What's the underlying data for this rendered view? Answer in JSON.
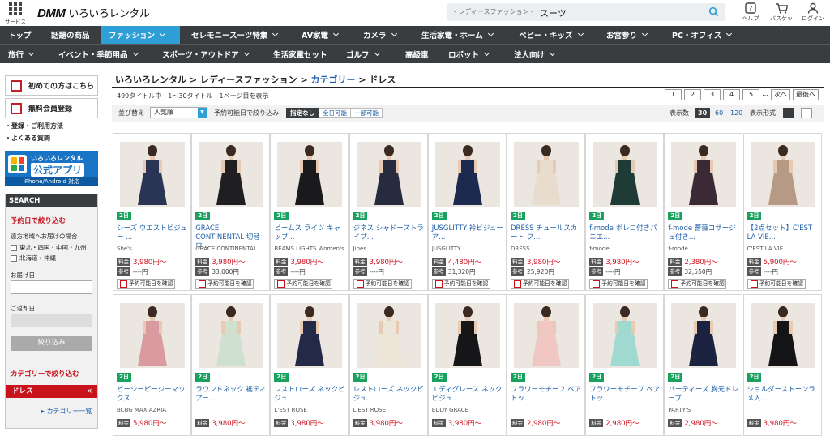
{
  "header": {
    "service_label": "サービス",
    "logo_brand": "DMM",
    "logo_site": "いろいろレンタル",
    "search": {
      "category": "- レディースファッション -",
      "query": "スーツ"
    },
    "icons": [
      {
        "label": "ヘルプ"
      },
      {
        "label": "バスケット"
      },
      {
        "label": "ログイン"
      }
    ]
  },
  "nav_row1": [
    "トップ",
    "話題の商品",
    "ファッション",
    "セレモニースーツ特集",
    "AV家電",
    "カメラ",
    "生活家電・ホーム",
    "ベビー・キッズ",
    "お宮参り",
    "PC・オフィス"
  ],
  "nav_row2": [
    "旅行",
    "イベント・季節用品",
    "スポーツ・アウトドア",
    "生活家電セット",
    "ゴルフ",
    "高級車",
    "ロボット",
    "法人向け"
  ],
  "sidebar": {
    "first_time": "初めての方はこちら",
    "register": "無料会員登録",
    "link_signup": "・登録・ご利用方法",
    "link_faq": "・よくある質問",
    "app_banner": {
      "line1": "いろいろレンタル",
      "line2": "公式アプリ",
      "line3": "iPhone/Android 対応"
    },
    "search_header": "SEARCH",
    "by_date": "予約日で絞り込む",
    "remote_label": "遠方地域へお届けの場合",
    "remote_opt1": "東北・四国・中国・九州",
    "remote_opt2": "北海道・沖縄",
    "delivery_date": "お届け日",
    "return_date": "ご返却日",
    "filter_button": "絞り込み",
    "by_category": "カテゴリーで絞り込む",
    "selected_category": "ドレス",
    "remove": "×",
    "category_list": "カテゴリー一覧"
  },
  "main": {
    "breadcrumb": {
      "a": "いろいろレンタル",
      "b": "レディースファッション",
      "c": "カテゴリー",
      "d": "ドレス",
      "sep": ">"
    },
    "count_text": "499タイトル中　1〜30タイトル　1ページ目を表示",
    "pager": [
      "1",
      "2",
      "3",
      "4",
      "5",
      "…",
      "次へ",
      "最後へ"
    ],
    "sort_label": "並び替え",
    "sort_value": "人気順",
    "avail_label": "予約可能日で絞り込み",
    "avail_opts": [
      "指定なし",
      "全日可能",
      "一部可能"
    ],
    "per_page_label": "表示数",
    "per_page": [
      "30",
      "60",
      "120"
    ],
    "format_label": "表示形式"
  },
  "products": [
    {
      "badge": "2日",
      "name": "シーズ ウエストビジュー ...",
      "brand": "She's",
      "price_tag": "料金",
      "price": "3,980円〜",
      "ref_tag": "参考",
      "ref": "----円",
      "avail": "予約可能日を確認",
      "dress": "#2a3454"
    },
    {
      "badge": "2日",
      "name": "GRACE CONTINENTAL 切替ワ...",
      "brand": "GRACE CONTINENTAL",
      "price_tag": "料金",
      "price": "3,980円〜",
      "ref_tag": "参考",
      "ref": "33,000円",
      "avail": "予約可能日を確認",
      "dress": "#1f1f22"
    },
    {
      "badge": "2日",
      "name": "ビームス ライツ キャップ...",
      "brand": "BEAMS LIGHTS Women's",
      "price_tag": "料金",
      "price": "3,980円〜",
      "ref_tag": "参考",
      "ref": "----円",
      "avail": "予約可能日を確認",
      "dress": "#1a1a1c"
    },
    {
      "badge": "2日",
      "name": "ジネス シャドーストライプ...",
      "brand": "Jines",
      "price_tag": "料金",
      "price": "3,980円〜",
      "ref_tag": "参考",
      "ref": "----円",
      "avail": "予約可能日を確認",
      "dress": "#262b3e"
    },
    {
      "badge": "2日",
      "name": "JUSGLITTY 衿ビジュー ア...",
      "brand": "JUSGLITTY",
      "price_tag": "料金",
      "price": "4,480円〜",
      "ref_tag": "参考",
      "ref": "31,320円",
      "avail": "予約可能日を確認",
      "dress": "#1d2a4f"
    },
    {
      "badge": "2日",
      "name": "DRESS チュールスカート フ...",
      "brand": "DRESS",
      "price_tag": "料金",
      "price": "3,980円〜",
      "ref_tag": "参考",
      "ref": "25,920円",
      "avail": "予約可能日を確認",
      "dress": "#e8dccd"
    },
    {
      "badge": "2日",
      "name": "f-mode ボレロ付きパニエ...",
      "brand": "f-mode",
      "price_tag": "料金",
      "price": "3,980円〜",
      "ref_tag": "参考",
      "ref": "----円",
      "avail": "予約可能日を確認",
      "dress": "#1f3b35"
    },
    {
      "badge": "2日",
      "name": "f-mode 薔薇コサージュ付き...",
      "brand": "f-mode",
      "price_tag": "料金",
      "price": "2,380円〜",
      "ref_tag": "参考",
      "ref": "32,550円",
      "avail": "予約可能日を確認",
      "dress": "#3b2a35"
    },
    {
      "badge": "2日",
      "name": "【2点セット】C'EST LA VIE...",
      "brand": "C'EST LA VIE",
      "price_tag": "料金",
      "price": "5,900円〜",
      "ref_tag": "参考",
      "ref": "----円",
      "avail": "予約可能日を確認",
      "dress": "#b69a86"
    },
    {
      "badge": "2日",
      "name": "ビーシービージーマックス...",
      "brand": "BCBG MAX AZRIA",
      "price_tag": "料金",
      "price": "5,980円〜",
      "ref_tag": "",
      "ref": "",
      "avail": "",
      "dress": "#d99aa0"
    },
    {
      "badge": "2日",
      "name": "ラウンドネック 裾ティアー...",
      "brand": "",
      "price_tag": "料金",
      "price": "3,980円〜",
      "ref_tag": "",
      "ref": "",
      "avail": "",
      "dress": "#cfe0cf"
    },
    {
      "badge": "2日",
      "name": "レストローズ ネックビジュ...",
      "brand": "L'EST ROSE",
      "price_tag": "料金",
      "price": "3,980円〜",
      "ref_tag": "",
      "ref": "",
      "avail": "",
      "dress": "#232946"
    },
    {
      "badge": "2日",
      "name": "レストローズ ネックビジュ...",
      "brand": "L'EST ROSE",
      "price_tag": "料金",
      "price": "3,980円〜",
      "ref_tag": "",
      "ref": "",
      "avail": "",
      "dress": "#ede5d7"
    },
    {
      "badge": "2日",
      "name": "エディグレース ネックビジュ...",
      "brand": "EDDY GRACE",
      "price_tag": "料金",
      "price": "3,980円〜",
      "ref_tag": "",
      "ref": "",
      "avail": "",
      "dress": "#161618"
    },
    {
      "badge": "2日",
      "name": "フラワーモチーフ ベアトッ...",
      "brand": "",
      "price_tag": "料金",
      "price": "2,980円〜",
      "ref_tag": "",
      "ref": "",
      "avail": "",
      "dress": "#f1c7c4"
    },
    {
      "badge": "2日",
      "name": "フラワーモチーフ ベアトッ...",
      "brand": "",
      "price_tag": "料金",
      "price": "2,980円〜",
      "ref_tag": "",
      "ref": "",
      "avail": "",
      "dress": "#9fd9d0"
    },
    {
      "badge": "2日",
      "name": "パーティーズ 胸元ドレープ...",
      "brand": "PARTY'S",
      "price_tag": "料金",
      "price": "2,980円〜",
      "ref_tag": "",
      "ref": "",
      "avail": "",
      "dress": "#1c2340"
    },
    {
      "badge": "2日",
      "name": "ショルダーストーンラメ入...",
      "brand": "",
      "price_tag": "料金",
      "price": "3,980円〜",
      "ref_tag": "",
      "ref": "",
      "avail": "",
      "dress": "#141416"
    }
  ],
  "colors": {
    "nav_bg": "#3a3d40",
    "nav_active": "#2f9fd8",
    "price_red": "#d1111f",
    "badge_green": "#19a15e",
    "link_blue": "#1e5fa8"
  }
}
